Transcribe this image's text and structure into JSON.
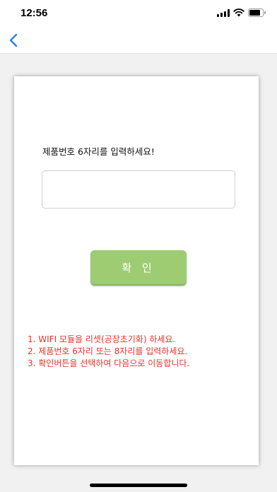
{
  "status_bar": {
    "time": "12:56",
    "battery_level": 0.85
  },
  "nav": {
    "back_icon": "chevron-left-icon"
  },
  "form": {
    "prompt": "제품번호 6자리를 입력하세요!",
    "serial_input_value": "",
    "confirm_label": "확 인",
    "confirm_color": "#9ecc73"
  },
  "instructions": [
    "1. WIFI 모듈을 리셋(공장초기화) 하세요.",
    "2. 제품번호 6자리 또는 8자리를 입력하세요.",
    "3. 확인버튼을 선택하여 다음으로 이동합니다."
  ],
  "colors": {
    "instruction_text": "#e33327",
    "back_icon": "#2f7cf6"
  }
}
